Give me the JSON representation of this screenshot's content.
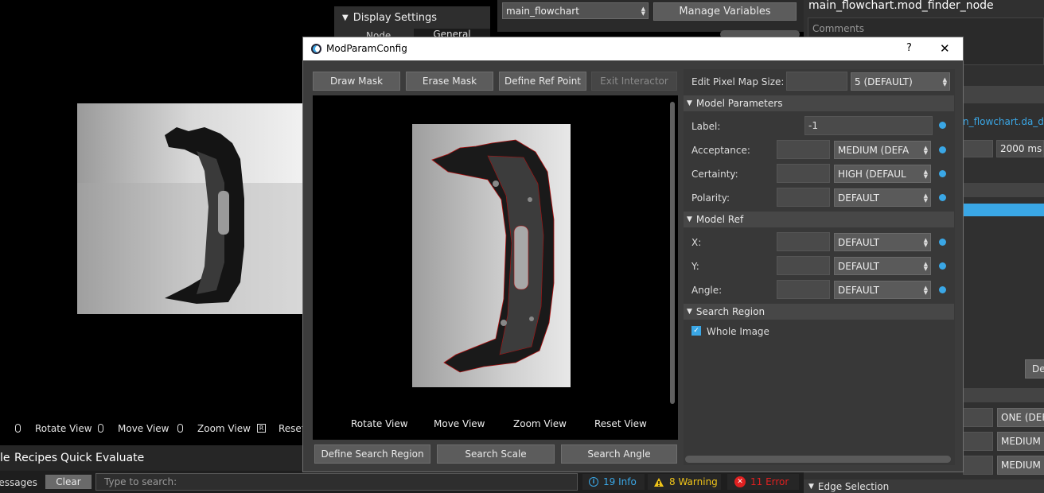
{
  "main_viewer": {
    "tools": [
      {
        "icon": "mouse-left-icon",
        "label": "Rotate View"
      },
      {
        "icon": "mouse-right-icon",
        "label": "Move View"
      },
      {
        "icon": "mouse-wheel-icon",
        "label": "Zoom View"
      },
      {
        "icon": "r-key-icon",
        "key": "R",
        "label": "Reset"
      }
    ]
  },
  "bottom_tabs": {
    "partial": "le",
    "recipes": "Recipes",
    "quick_evaluate": "Quick Evaluate"
  },
  "messages_bar": {
    "label": "Messages",
    "clear": "Clear",
    "search_placeholder": "Type to search:",
    "info": "19 Info",
    "warning": "8 Warning",
    "error": "11 Error"
  },
  "display_settings": {
    "title": "Display Settings",
    "tab_node": "Node",
    "tab_general": "General"
  },
  "top_bar": {
    "flowchart": "main_flowchart",
    "manage_variables": "Manage Variables"
  },
  "right_panel": {
    "title": "main_flowchart.mod_finder_node",
    "comments": "Comments",
    "link_text": "n_flowchart.da_de",
    "timeout": "2000 ms",
    "delete_partial": "Del",
    "combo_one": "ONE (DEF",
    "combo_medium1": "MEDIUM",
    "combo_medium2": "MEDIUM",
    "edge_selection": "Edge Selection"
  },
  "dialog": {
    "title": "ModParamConfig",
    "help": "?",
    "close": "✕",
    "toolbar": {
      "draw_mask": "Draw Mask",
      "erase_mask": "Erase Mask",
      "define_ref_point": "Define Ref Point",
      "exit_interactor": "Exit Interactor"
    },
    "viewer_tools": {
      "rotate": "Rotate View",
      "move": "Move View",
      "zoom": "Zoom View",
      "reset": "Reset View"
    },
    "bottom_buttons": {
      "define_search_region": "Define Search Region",
      "search_scale": "Search Scale",
      "search_angle": "Search Angle"
    },
    "params": {
      "pixel_map_label": "Edit Pixel Map Size:",
      "pixel_map_value": "",
      "pixel_map_combo": "5 (DEFAULT)",
      "model_parameters": "Model Parameters",
      "label_label": "Label:",
      "label_value": "-1",
      "acceptance_label": "Acceptance:",
      "acceptance_combo": "MEDIUM (DEFA",
      "certainty_label": "Certainty:",
      "certainty_combo": "HIGH (DEFAUL",
      "polarity_label": "Polarity:",
      "polarity_combo": "DEFAULT",
      "model_ref": "Model Ref",
      "x_label": "X:",
      "x_combo": "DEFAULT",
      "y_label": "Y:",
      "y_combo": "DEFAULT",
      "angle_label": "Angle:",
      "angle_combo": "DEFAULT",
      "search_region": "Search Region",
      "whole_image": "Whole Image",
      "whole_image_checked": true
    }
  },
  "colors": {
    "accent": "#3aa7e6",
    "dialog_bg": "#3c3c3c",
    "titlebar": "#ffffff"
  }
}
